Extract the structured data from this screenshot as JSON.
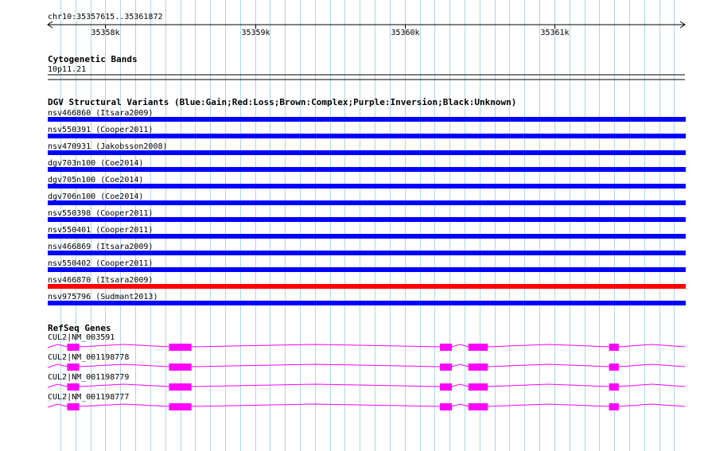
{
  "region": {
    "label": "chr10:35357615..35361872",
    "start": 35357615,
    "end": 35361872,
    "ticks": [
      {
        "position": 35358000,
        "label": "35358k"
      },
      {
        "position": 35359000,
        "label": "35359k"
      },
      {
        "position": 35360000,
        "label": "35360k"
      },
      {
        "position": 35361000,
        "label": "35361k"
      }
    ]
  },
  "colors": {
    "gridline": "#a8d8e8",
    "gain": "#0000ff",
    "loss": "#ff0000",
    "gene": "#ff00ff",
    "ruler": "#000000"
  },
  "cytoband": {
    "title": "Cytogenetic Bands",
    "band": "10p11.21"
  },
  "dgv": {
    "title": "DGV Structural Variants (Blue:Gain;Red:Loss;Brown:Complex;Purple:Inversion;Black:Unknown)",
    "variants": [
      {
        "label": "nsv466860 (Itsara2009)",
        "type": "gain"
      },
      {
        "label": "nsv550391 (Cooper2011)",
        "type": "gain"
      },
      {
        "label": "nsv470931 (Jakobsson2008)",
        "type": "gain"
      },
      {
        "label": "dgv703n100 (Coe2014)",
        "type": "gain"
      },
      {
        "label": "dgv705n100 (Coe2014)",
        "type": "gain"
      },
      {
        "label": "dgv706n100 (Coe2014)",
        "type": "gain"
      },
      {
        "label": "nsv550398 (Cooper2011)",
        "type": "gain"
      },
      {
        "label": "nsv550401 (Cooper2011)",
        "type": "gain"
      },
      {
        "label": "nsv466869 (Itsara2009)",
        "type": "gain"
      },
      {
        "label": "nsv550402 (Cooper2011)",
        "type": "gain"
      },
      {
        "label": "nsv466870 (Itsara2009)",
        "type": "loss"
      },
      {
        "label": "nsv975796 (Sudmant2013)",
        "type": "gain"
      }
    ]
  },
  "refseq": {
    "title": "RefSeq Genes",
    "transcripts": [
      {
        "label": "CUL2|NM_003591",
        "exons": [
          [
            35357745,
            35357825
          ],
          [
            35358425,
            35358575
          ],
          [
            35360235,
            35360315
          ],
          [
            35360425,
            35360555
          ],
          [
            35361365,
            35361430
          ]
        ]
      },
      {
        "label": "CUL2|NM_001198778",
        "exons": [
          [
            35357745,
            35357825
          ],
          [
            35358425,
            35358575
          ],
          [
            35360235,
            35360315
          ],
          [
            35360425,
            35360555
          ],
          [
            35361365,
            35361430
          ]
        ]
      },
      {
        "label": "CUL2|NM_001198779",
        "exons": [
          [
            35357745,
            35357825
          ],
          [
            35358425,
            35358575
          ],
          [
            35360235,
            35360315
          ],
          [
            35360425,
            35360555
          ],
          [
            35361365,
            35361430
          ]
        ]
      },
      {
        "label": "CUL2|NM_001198777",
        "exons": [
          [
            35357745,
            35357825
          ],
          [
            35358425,
            35358575
          ],
          [
            35360235,
            35360315
          ],
          [
            35360425,
            35360555
          ],
          [
            35361365,
            35361430
          ]
        ]
      }
    ]
  }
}
